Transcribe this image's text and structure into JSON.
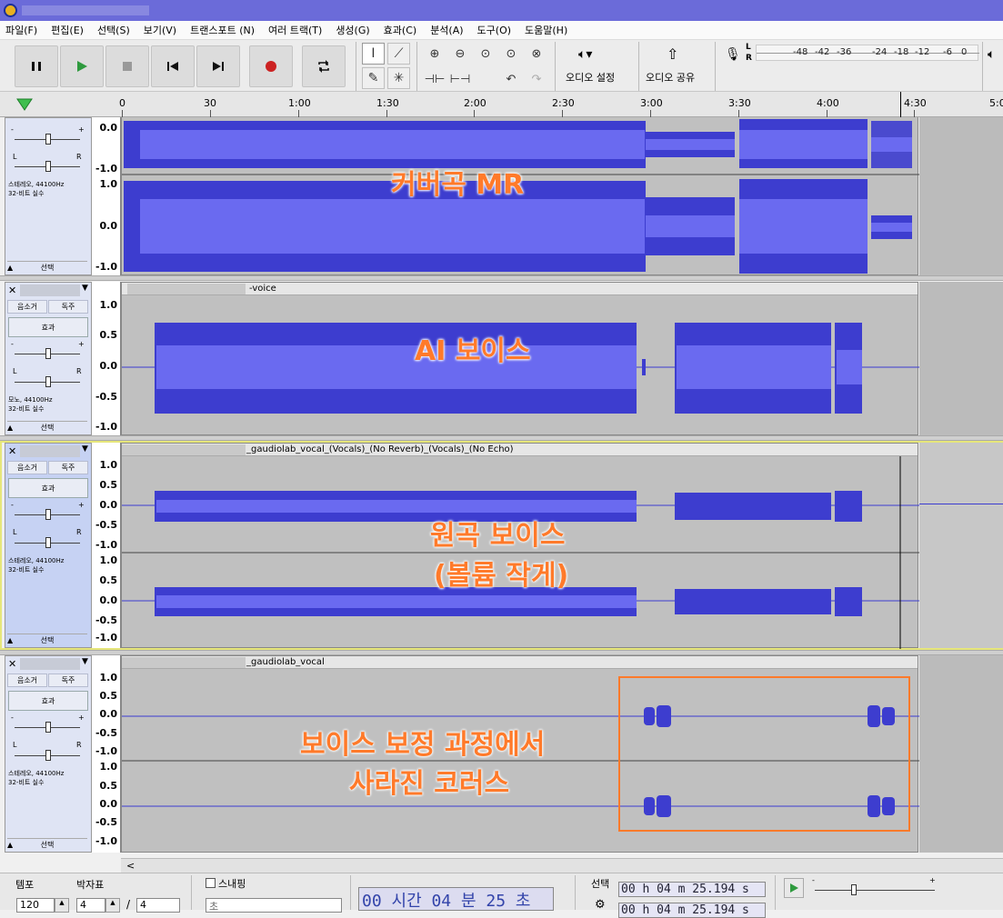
{
  "menubar": [
    "파일(F)",
    "편집(E)",
    "선택(S)",
    "보기(V)",
    "트랜스포트 (N)",
    "여러 트랙(T)",
    "생성(G)",
    "효과(C)",
    "분석(A)",
    "도구(O)",
    "도움말(H)"
  ],
  "toolbar": {
    "audio_setup": "오디오 설정",
    "audio_share": "오디오 공유",
    "meter_ticks": [
      "-48",
      "-42",
      "-36",
      "-24",
      "-18",
      "-12",
      "-6",
      "0"
    ],
    "meter_L": "L",
    "meter_R": "R"
  },
  "ruler": {
    "ticks": [
      "0",
      "30",
      "1:00",
      "1:30",
      "2:00",
      "2:30",
      "3:00",
      "3:30",
      "4:00",
      "4:30",
      "5:0"
    ]
  },
  "track_panel": {
    "mute": "음소거",
    "solo": "독주",
    "effects": "효과",
    "select": "선택",
    "pan_L": "L",
    "pan_R": "R",
    "gain_minus": "-",
    "gain_plus": "+"
  },
  "tracks": [
    {
      "info1": "스테레오, 44100Hz",
      "info2": "32-비트 실수",
      "clip_name": "",
      "scale_stereo": [
        "0.0",
        "-1.0",
        "1.0",
        "0.0",
        "-1.0"
      ]
    },
    {
      "info1": "모노, 44100Hz",
      "info2": "32-비트 실수",
      "clip_name": "-voice",
      "scale": [
        "1.0",
        "0.5",
        "0.0",
        "-0.5",
        "-1.0"
      ]
    },
    {
      "info1": "스테레오, 44100Hz",
      "info2": "32-비트 실수",
      "clip_name": "_gaudiolab_vocal_(Vocals)_(No Reverb)_(Vocals)_(No Echo)",
      "scale": [
        "1.0",
        "0.5",
        "0.0",
        "-0.5",
        "-1.0",
        "1.0",
        "0.5",
        "0.0",
        "-0.5",
        "-1.0"
      ]
    },
    {
      "info1": "스테레오, 44100Hz",
      "info2": "32-비트 실수",
      "clip_name": "_gaudiolab_vocal",
      "scale": [
        "1.0",
        "0.5",
        "0.0",
        "-0.5",
        "-1.0",
        "1.0",
        "0.5",
        "0.0",
        "-0.5",
        "-1.0"
      ]
    }
  ],
  "annotations": {
    "mr": "커버곡 MR",
    "ai": "AI 보이스",
    "orig1": "원곡 보이스",
    "orig2": "(볼륨 작게)",
    "lost1": "보이스 보정 과정에서",
    "lost2": "사라진 코러스"
  },
  "bottom": {
    "tempo_label": "템포",
    "tempo_value": "120",
    "timesig_label": "박자표",
    "timesig_num": "4",
    "timesig_slash": "/",
    "timesig_den": "4",
    "snap_label": "스내핑",
    "snap_value": "초",
    "time_display": "00 시간 04 분 25 초",
    "selection_label": "선택",
    "sel_start": "00 h 04 m 25.194 s",
    "sel_end": "00 h 04 m 25.194 s"
  }
}
